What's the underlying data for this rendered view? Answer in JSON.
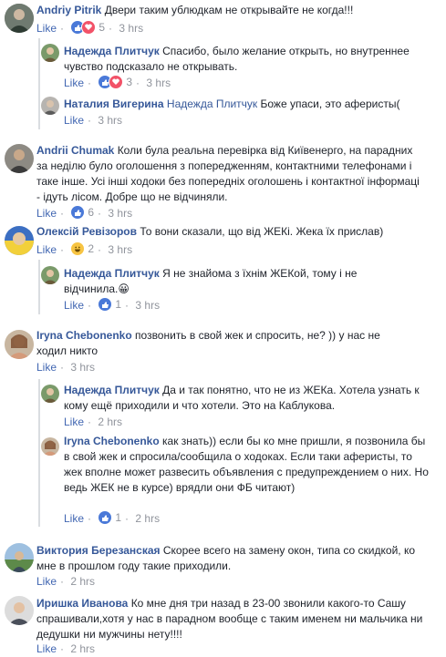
{
  "like_label": "Like",
  "comments": [
    {
      "author": "Andriy Pitrik",
      "text": "Двери таким ублюдкам не открывайте не когда!!!",
      "reactions": "5",
      "time": "3 hrs"
    },
    {
      "author": "Надежда Плитчук",
      "text": "Спасибо, было желание открыть, но внутреннее чувство подсказало не открывать.",
      "reactions": "3",
      "time": "3 hrs"
    },
    {
      "author": "Наталия Вигерина",
      "mention": "Надежда Плитчук",
      "text": "Боже упаси, это аферисты(",
      "time": "3 hrs"
    },
    {
      "author": "Andrii Chumak",
      "text": "Коли була реальна перевірка від Київенерго, на парадних за неділю було оголошення з попередженням, контактними телефонами і таке інше. Усі інші ходоки без попередніх оголошень і контактної інформаці - ідуть лісом. Добре що не відчиняли.",
      "reactions": "6",
      "time": "3 hrs"
    },
    {
      "author": "Олексій Ревізоров",
      "text": "То вони сказали, що від ЖЕКі. Жека їх прислав)",
      "reactions": "2",
      "time": "3 hrs"
    },
    {
      "author": "Надежда Плитчук",
      "text": "Я не знайома з їхнім ЖЕКой, тому і не відчинила.😀",
      "reactions": "1",
      "time": "3 hrs"
    },
    {
      "author": "Iryna Chebonenko",
      "text": "позвонить в свой жек и спросить, не? )) у нас не ходил никто",
      "time": "3 hrs"
    },
    {
      "author": "Надежда Плитчук",
      "text": "Да и так понятно, что не из ЖЕКа. Хотела узнать к кому ещё приходили и что хотели. Это на Каблукова.",
      "time": "2 hrs"
    },
    {
      "author": "Iryna Chebonenko",
      "text": "как знать)) если бы ко мне пришли, я позвонила бы в свой жек и спросила/сообщила о ходоках. Если таки аферисты, то жек вполне может развесить объявления с предупреждением о них. Но ведь ЖЕК не в курсе) врядли они ФБ читают)",
      "reactions": "1",
      "time": "2 hrs"
    },
    {
      "author": "Виктория Березанская",
      "text": "Скорее всего на замену окон, типа со скидкой, ко мне в прошлом году такие приходили.",
      "time": "2 hrs"
    },
    {
      "author": "Иришка Иванова",
      "text": "Ко мне дня три назад в 23-00 звонили какого-то Сашу спрашивали,хотя у нас в парадном вообще с таким именем ни мальчика ни дедушки ни мужчины нету!!!!",
      "time": "2 hrs"
    }
  ],
  "colors": {
    "link": "#365899",
    "like": "#4267b2",
    "meta": "#90949c",
    "text": "#1d2129",
    "thread_line": "#dadde1"
  }
}
